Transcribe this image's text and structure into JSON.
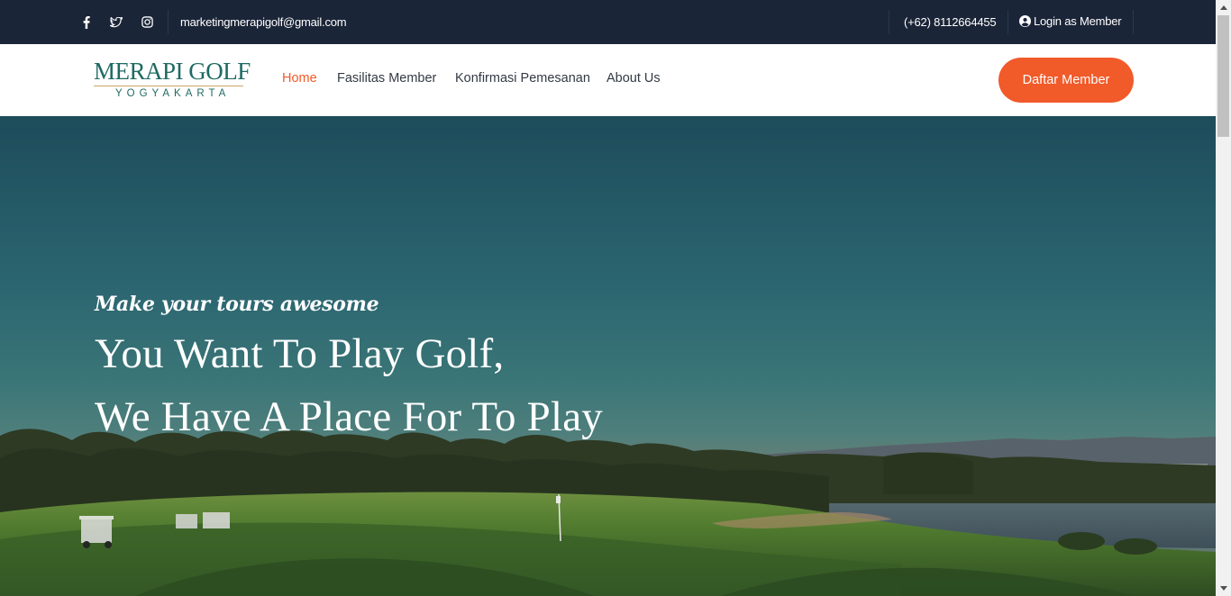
{
  "topbar": {
    "social_icons": [
      "facebook-icon",
      "twitter-icon",
      "instagram-icon"
    ],
    "email": "marketingmerapigolf@gmail.com",
    "phone": "(+62) 8112664455",
    "login_label": "Login as Member"
  },
  "navbar": {
    "logo_main": "MERAPI GOLF",
    "logo_sub": "YOGYAKARTA",
    "items": [
      {
        "label": "Home",
        "active": true
      },
      {
        "label": "Fasilitas Member",
        "active": false
      },
      {
        "label": "Konfirmasi Pemesanan",
        "active": false
      },
      {
        "label": "About Us",
        "active": false
      }
    ],
    "cta_label": "Daftar Member"
  },
  "hero": {
    "tagline": "Make your tours awesome",
    "title_line1": "You Want To Play Golf,",
    "title_line2": "We Have A Place For To Play"
  },
  "colors": {
    "topbar_bg": "#1b2538",
    "accent": "#f15a29",
    "logo_green": "#1f6a63",
    "nav_text": "#333a44"
  }
}
